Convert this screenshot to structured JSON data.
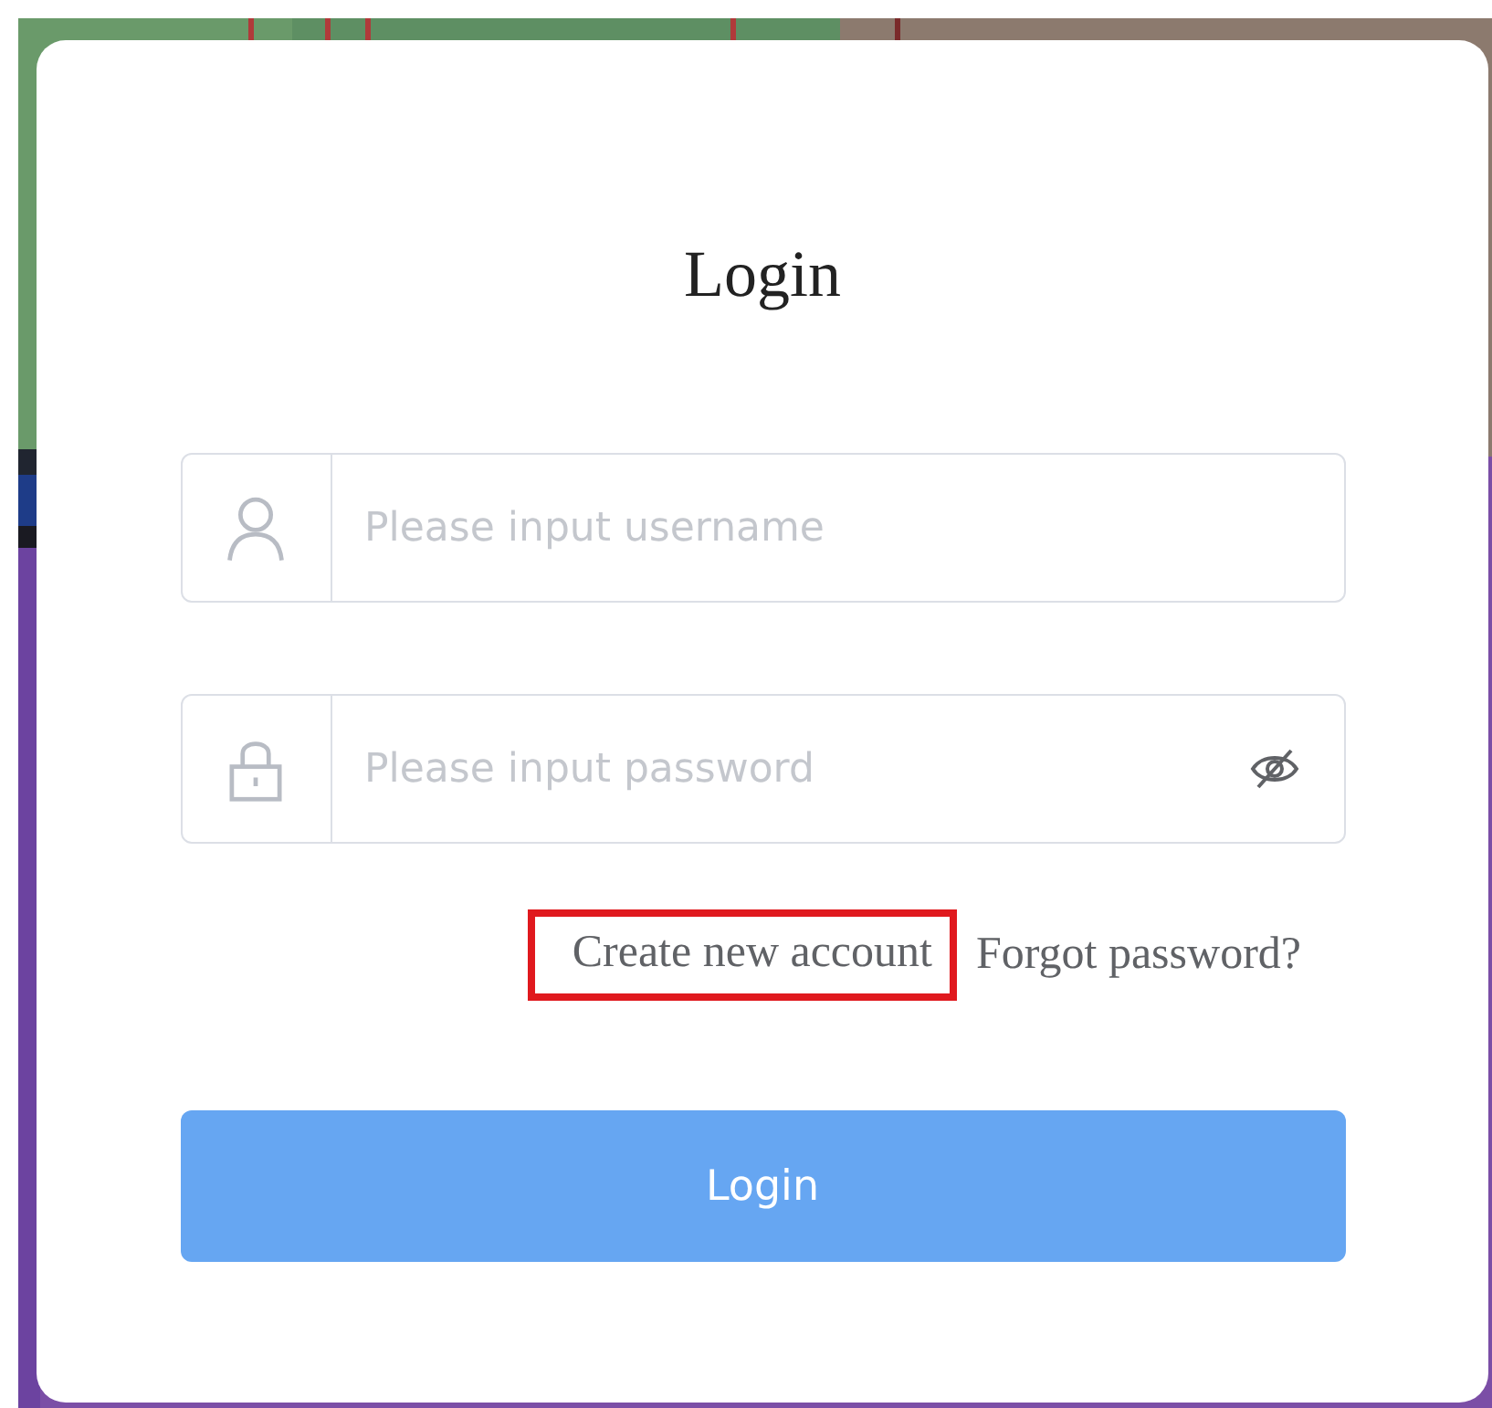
{
  "title": "Login",
  "fields": [
    {
      "kind": "username",
      "placeholder": "Please input username"
    },
    {
      "kind": "password",
      "placeholder": "Please input password",
      "revealed": false
    }
  ],
  "links": [
    {
      "label": "Create new account",
      "highlighted": true
    },
    {
      "label": "Forgot password?",
      "highlighted": false
    }
  ],
  "button": {
    "label": "Login"
  }
}
